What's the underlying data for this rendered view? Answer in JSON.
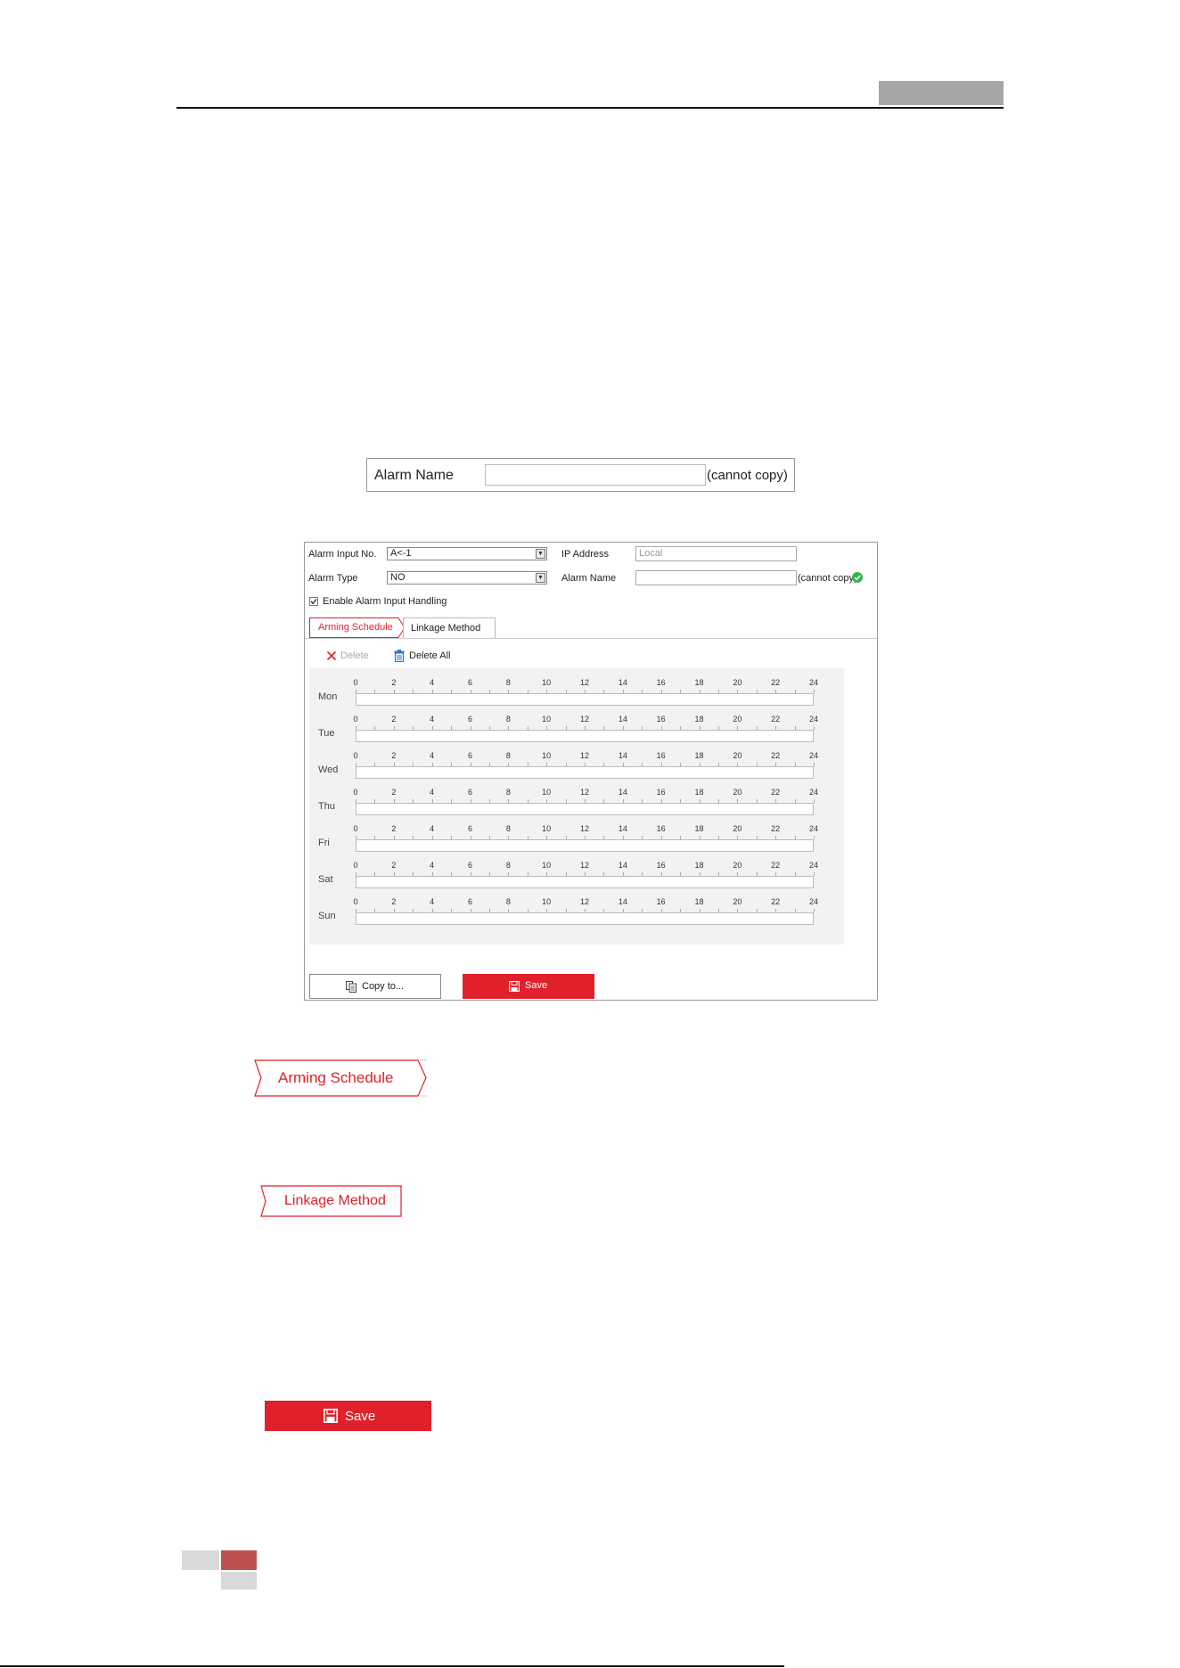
{
  "alarm_name_snippet": {
    "label": "Alarm Name",
    "value": "",
    "suffix": "(cannot copy)"
  },
  "panel": {
    "alarm_input_no": {
      "label": "Alarm Input No.",
      "value": "A<-1"
    },
    "ip_address": {
      "label": "IP Address",
      "placeholder": "Local"
    },
    "alarm_type": {
      "label": "Alarm Type",
      "value": "NO"
    },
    "alarm_name": {
      "label": "Alarm Name",
      "value": "",
      "suffix": "(cannot copy)"
    },
    "enable_handling": {
      "label": "Enable Alarm Input Handling",
      "checked": true
    },
    "tabs": [
      {
        "label": "Arming Schedule",
        "active": true
      },
      {
        "label": "Linkage Method",
        "active": false
      }
    ],
    "toolbar": {
      "delete_label": "Delete",
      "delete_all_label": "Delete All"
    },
    "schedule": {
      "hours": [
        "0",
        "2",
        "4",
        "6",
        "8",
        "10",
        "12",
        "14",
        "16",
        "18",
        "20",
        "22",
        "24"
      ],
      "days": [
        "Mon",
        "Tue",
        "Wed",
        "Thu",
        "Fri",
        "Sat",
        "Sun"
      ]
    },
    "copy_label": "Copy to...",
    "save_label": "Save"
  },
  "standalone": {
    "arming_schedule_tab": "Arming Schedule",
    "linkage_method_tab": "Linkage Method",
    "save_button": "Save"
  },
  "colors": {
    "accent_red": "#e0212b",
    "success_green": "#2db84d",
    "header_gray": "#a6a6a6",
    "footer_red": "#c0504d"
  }
}
